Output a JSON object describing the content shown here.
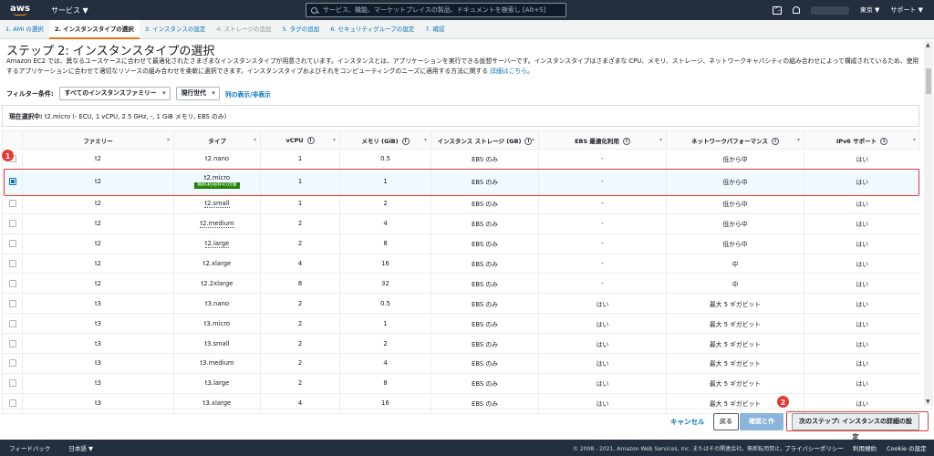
{
  "nav": {
    "logo": "aws",
    "services": "サービス ▼",
    "search_placeholder": "サービス、機能、マーケットプレイスの製品、ドキュメントを検索し   [Alt+S]",
    "region": "東京 ▼",
    "support": "サポート ▼",
    "icons": [
      "terminal-icon",
      "bell-icon"
    ]
  },
  "steps": [
    {
      "label": "1. AMI の選択",
      "state": "done"
    },
    {
      "label": "2. インスタンスタイプの選択",
      "state": "active"
    },
    {
      "label": "3. インスタンスの設定",
      "state": "done"
    },
    {
      "label": "4. ストレージの追加",
      "state": "disabled"
    },
    {
      "label": "5. タグの追加",
      "state": "done"
    },
    {
      "label": "6. セキュリティグループの設定",
      "state": "done"
    },
    {
      "label": "7. 確認",
      "state": "done"
    }
  ],
  "page": {
    "title": "ステップ 2: インスタンスタイプの選択",
    "description": "Amazon EC2 では、異なるユースケースに合わせて最適化されたさまざまなインスタンスタイプが用意されています。インスタンスとは、アプリケーションを実行できる仮想サーバーです。インスタンスタイプはさまざまな CPU、メモリ、ストレージ、ネットワークキャパシティの組み合わせによって構成されているため、使用するアプリケーションに合わせて適切なリソースの組み合わせを柔軟に選択できます。インスタンスタイプおよびそれをコンピューティングのニーズに適用する方法に関する",
    "description_link": "詳細はこちら",
    "description_end": "。"
  },
  "filter": {
    "label": "フィルター条件:",
    "family": "すべてのインスタンスファミリー",
    "generation": "現行世代",
    "columns_link": "列の表示/非表示"
  },
  "current_selection": {
    "label": "現在選択中:",
    "value": " t2.micro (- ECU, 1 vCPU, 2.5 GHz, -, 1 GiB メモリ, EBS のみ)"
  },
  "table": {
    "headers": [
      "ファミリー",
      "タイプ",
      "vCPU",
      "メモリ (GiB)",
      "インスタンス ストレージ (GB)",
      "EBS 最適化利用",
      "ネットワークパフォーマンス",
      "IPv6 サポート"
    ],
    "free_tier_badge": "無料利用枠の対象",
    "rows": [
      {
        "family": "t2",
        "type": "t2.nano",
        "vcpu": "1",
        "memory": "0.5",
        "storage": "EBS のみ",
        "ebs": "-",
        "network": "低から中",
        "ipv6": "はい"
      },
      {
        "family": "t2",
        "type": "t2.micro",
        "vcpu": "1",
        "memory": "1",
        "storage": "EBS のみ",
        "ebs": "-",
        "network": "低から中",
        "ipv6": "はい",
        "selected": true
      },
      {
        "family": "t2",
        "type": "t2.small",
        "vcpu": "1",
        "memory": "2",
        "storage": "EBS のみ",
        "ebs": "-",
        "network": "低から中",
        "ipv6": "はい"
      },
      {
        "family": "t2",
        "type": "t2.medium",
        "vcpu": "2",
        "memory": "4",
        "storage": "EBS のみ",
        "ebs": "-",
        "network": "低から中",
        "ipv6": "はい"
      },
      {
        "family": "t2",
        "type": "t2.large",
        "vcpu": "2",
        "memory": "8",
        "storage": "EBS のみ",
        "ebs": "-",
        "network": "低から中",
        "ipv6": "はい"
      },
      {
        "family": "t2",
        "type": "t2.xlarge",
        "vcpu": "4",
        "memory": "16",
        "storage": "EBS のみ",
        "ebs": "-",
        "network": "中",
        "ipv6": "はい"
      },
      {
        "family": "t2",
        "type": "t2.2xlarge",
        "vcpu": "8",
        "memory": "32",
        "storage": "EBS のみ",
        "ebs": "-",
        "network": "中",
        "ipv6": "はい"
      },
      {
        "family": "t3",
        "type": "t3.nano",
        "vcpu": "2",
        "memory": "0.5",
        "storage": "EBS のみ",
        "ebs": "はい",
        "network": "最大 5 ギガビット",
        "ipv6": "はい"
      },
      {
        "family": "t3",
        "type": "t3.micro",
        "vcpu": "2",
        "memory": "1",
        "storage": "EBS のみ",
        "ebs": "はい",
        "network": "最大 5 ギガビット",
        "ipv6": "はい"
      },
      {
        "family": "t3",
        "type": "t3.small",
        "vcpu": "2",
        "memory": "2",
        "storage": "EBS のみ",
        "ebs": "はい",
        "network": "最大 5 ギガビット",
        "ipv6": "はい"
      },
      {
        "family": "t3",
        "type": "t3.medium",
        "vcpu": "2",
        "memory": "4",
        "storage": "EBS のみ",
        "ebs": "はい",
        "network": "最大 5 ギガビット",
        "ipv6": "はい"
      },
      {
        "family": "t3",
        "type": "t3.large",
        "vcpu": "2",
        "memory": "8",
        "storage": "EBS のみ",
        "ebs": "はい",
        "network": "最大 5 ギガビット",
        "ipv6": "はい"
      },
      {
        "family": "t3",
        "type": "t3.xlarge",
        "vcpu": "4",
        "memory": "16",
        "storage": "EBS のみ",
        "ebs": "はい",
        "network": "最大 5 ギガビット",
        "ipv6": "はい"
      }
    ]
  },
  "annotations": {
    "marker1": "1",
    "marker2": "2"
  },
  "footer": {
    "cancel": "キャンセル",
    "back": "戻る",
    "review": "確認と作成",
    "next": "次のステップ: インスタンスの詳細の設定"
  },
  "bottom": {
    "feedback": "フィードバック",
    "language": "日本語 ▼",
    "copyright": "© 2008 - 2021, Amazon Web Services, Inc. またはその関連会社。無断転用禁止。",
    "privacy": "プライバシーポリシー",
    "terms": "利用規約",
    "cookie": "Cookie の設定"
  },
  "colors": {
    "nav_bg": "#232f3e",
    "accent": "#ec7211",
    "link": "#0073bb",
    "annotation": "#e53935",
    "free_tier": "#1d8102"
  }
}
